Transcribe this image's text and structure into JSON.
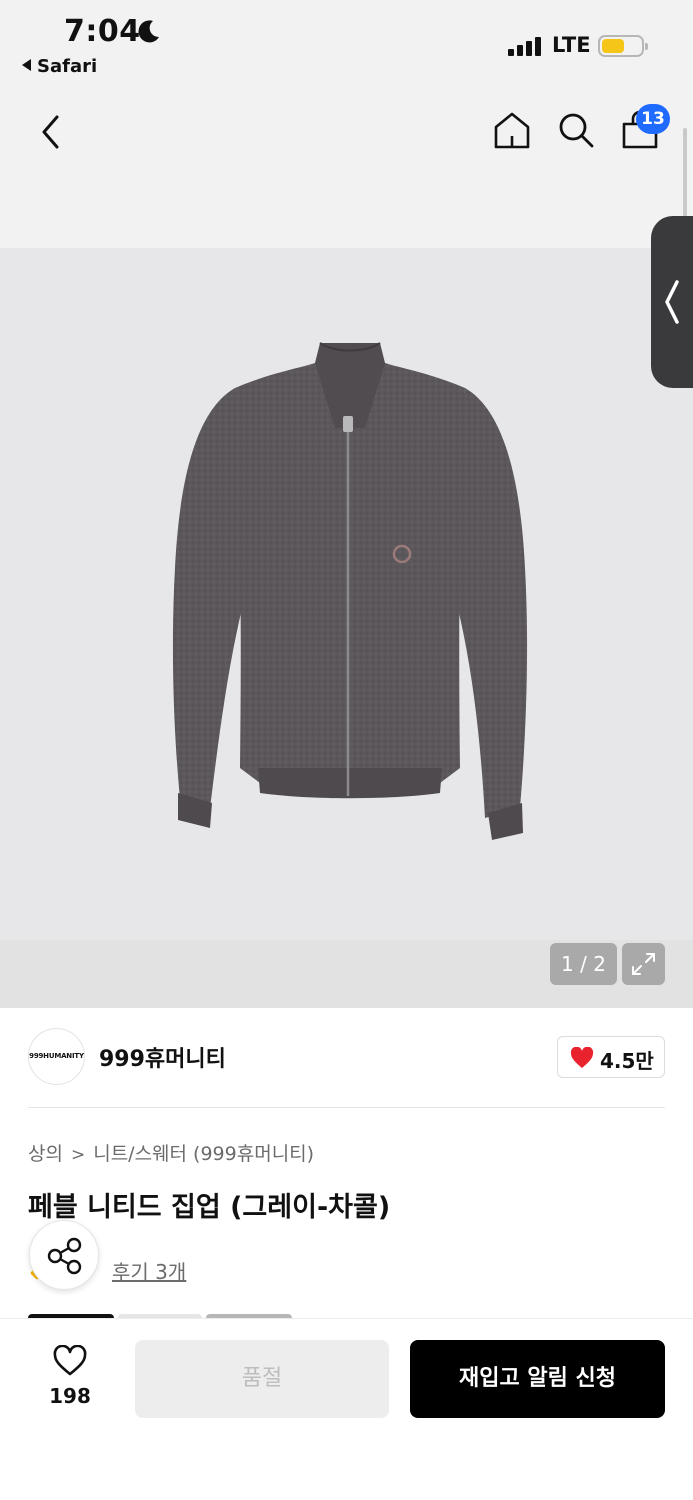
{
  "status_bar": {
    "time": "7:04",
    "back_app_label": "Safari",
    "network": "LTE"
  },
  "nav": {
    "cart_count": "13"
  },
  "gallery": {
    "counter": "1 / 2"
  },
  "brand": {
    "logo_text": "999HUMANITY",
    "name": "999휴머니티",
    "likes": "4.5만"
  },
  "breadcrumb": {
    "category": "상의",
    "subcategory": "니트/스웨터 (999휴머니티)"
  },
  "product": {
    "title": "페블 니티드 집업 (그레이-차콜)",
    "review_link": "후기 3개"
  },
  "bottom_bar": {
    "wish_count": "198",
    "soldout_label": "품절",
    "restock_label": "재입고 알림 신청"
  },
  "colors": {
    "accent_blue": "#1f6bff",
    "heart_red": "#e8232e",
    "battery_yellow": "#f5c518",
    "primary_black": "#000000"
  }
}
